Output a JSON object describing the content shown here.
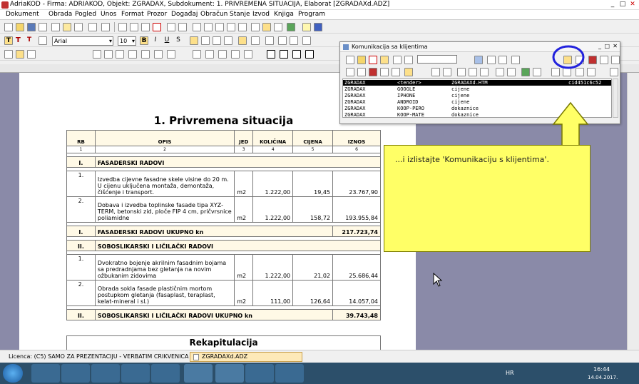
{
  "window": {
    "title": "AdriaKOD - Firma: ADRIAKOD,  Objekt: ZGRADAX,  Subdokument: 1. PRIVREMENA SITUACIJA,  Elaborat [ZGRADAXd.ADZ]",
    "min": "_",
    "max": "□",
    "close": "✕"
  },
  "menu": [
    "Dokument",
    "Obrada",
    "Pogled",
    "Unos",
    "Format",
    "Prozor",
    "Događaj",
    "Obračun",
    "Stanje",
    "Izvod",
    "Knjiga",
    "Program"
  ],
  "format_toolbar": {
    "font": "Arial",
    "size": "10",
    "bold": "B",
    "italic": "I",
    "underline": "U",
    "strike": "S",
    "t_icons": [
      "T",
      "T",
      "T"
    ]
  },
  "document": {
    "title": "1. Privremena situacija",
    "headers": [
      "RB",
      "OPIS",
      "JED",
      "KOLIČINA",
      "CIJENA",
      "IZNOS"
    ],
    "col_numbers": [
      "1",
      "2",
      "3",
      "4",
      "5",
      "6"
    ],
    "sections": [
      {
        "rb": "I.",
        "title": "FASADERSKI RADOVI",
        "items": [
          {
            "rb": "1.",
            "opis": "Izvedba cijevne fasadne skele visine do 20 m. U cijenu uključena montaža, demontaža, čišćenje i transport.",
            "jed": "m2",
            "kol": "1.222,00",
            "cij": "19,45",
            "iznos": "23.767,90"
          },
          {
            "rb": "2.",
            "opis": "Dobava i izvedba toplinske fasade tipa XYZ-TERM, betonski zid, ploče FIP 4 cm, pričvrsnice poliamidne",
            "jed": "m2",
            "kol": "1.222,00",
            "cij": "158,72",
            "iznos": "193.955,84"
          }
        ],
        "total_rb": "I.",
        "total_label": "FASADERSKI RADOVI UKUPNO kn",
        "total": "217.723,74"
      },
      {
        "rb": "II.",
        "title": "SOBOSLIKARSKI I LIČILAČKI RADOVI",
        "items": [
          {
            "rb": "1.",
            "opis": "Dvokratno bojenje akrilnim fasadnim bojama sa predradnjama bez gletanja na novim ožbukanim zidovima",
            "jed": "m2",
            "kol": "1.222,00",
            "cij": "21,02",
            "iznos": "25.686,44"
          },
          {
            "rb": "2.",
            "opis": "Obrada sokla fasade plastičnim mortom postupkom gletanja (fasaplast, teraplast, kelat-mineral i sl.)",
            "jed": "m2",
            "kol": "111,00",
            "cij": "126,64",
            "iznos": "14.057,04"
          }
        ],
        "total_rb": "II.",
        "total_label": "SOBOSLIKARSKI I LIČILAČKI RADOVI UKUPNO kn",
        "total": "39.743,48"
      }
    ],
    "partial_next": "Rekapitulacija"
  },
  "komunikacija": {
    "title": "Komunikacija sa klijentima",
    "rows": [
      {
        "a": "ZGRADAX",
        "b": "<tender>",
        "c": "ZGRADAXd.HTM",
        "d": "cid451c6c52",
        "selected": true
      },
      {
        "a": "ZGRADAX",
        "b": "GOOGLE",
        "c": "cijene",
        "d": ""
      },
      {
        "a": "ZGRADAX",
        "b": "IPHONE",
        "c": "cijene",
        "d": ""
      },
      {
        "a": "ZGRADAX",
        "b": "ANDROID",
        "c": "cijene",
        "d": ""
      },
      {
        "a": "ZGRADAX",
        "b": "KOOP-PERO",
        "c": "dokaznice",
        "d": ""
      },
      {
        "a": "ZGRADAX",
        "b": "KOOP-MATE",
        "c": "dokaznice",
        "d": ""
      }
    ]
  },
  "callout": {
    "text": "...i izlistajte 'Komunikaciju s klijentima'."
  },
  "status": {
    "licence": "Licenca:  (C5) SAMO ZA PREZENTACIJU - VERBATIM CRIKVENICA",
    "file": "ZGRADAXd.ADZ"
  },
  "taskbar": {
    "lang": "HR",
    "time": "16:44",
    "date": "14.04.2017."
  },
  "colors": {
    "callout": "#ffff66",
    "highlight_circle": "#2222dd",
    "doc_bg": "#8a8aa8",
    "taskbar": "#2c4f6a"
  }
}
